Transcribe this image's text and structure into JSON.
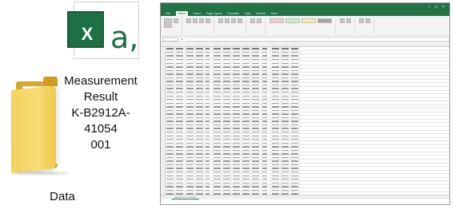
{
  "folder": {
    "label": "Data"
  },
  "file": {
    "icon_letter": "X",
    "icon_suffix": "a,",
    "label_lines": [
      "Measurement",
      "Result",
      "K-B2912A-41054",
      "001"
    ]
  },
  "excel": {
    "ribbon_tabs": [
      "File",
      "Home",
      "Insert",
      "Page Layout",
      "Formulas",
      "Data",
      "Review",
      "View"
    ],
    "sheet_tab": "Measurement Result"
  },
  "colors": {
    "excel_green": "#217346",
    "folder_yellow": "#f4d25e"
  }
}
